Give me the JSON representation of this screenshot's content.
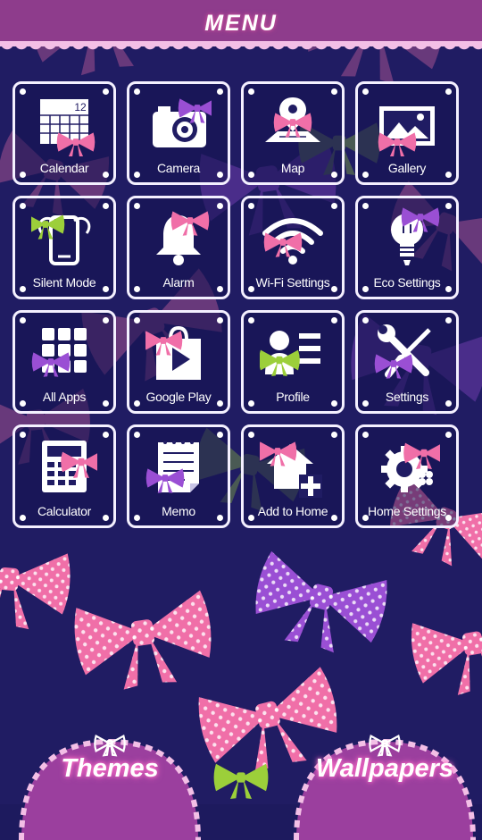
{
  "header": {
    "title": "MENU"
  },
  "tiles": [
    {
      "label": "Calendar",
      "icon": "calendar-icon"
    },
    {
      "label": "Camera",
      "icon": "camera-icon"
    },
    {
      "label": "Map",
      "icon": "map-icon"
    },
    {
      "label": "Gallery",
      "icon": "gallery-icon"
    },
    {
      "label": "Silent Mode",
      "icon": "silent-mode-icon"
    },
    {
      "label": "Alarm",
      "icon": "alarm-bell-icon"
    },
    {
      "label": "Wi-Fi Settings",
      "icon": "wifi-icon"
    },
    {
      "label": "Eco Settings",
      "icon": "lightbulb-icon"
    },
    {
      "label": "All Apps",
      "icon": "all-apps-grid-icon"
    },
    {
      "label": "Google Play",
      "icon": "google-play-bag-icon"
    },
    {
      "label": "Profile",
      "icon": "profile-icon"
    },
    {
      "label": "Settings",
      "icon": "wrench-screwdriver-icon"
    },
    {
      "label": "Calculator",
      "icon": "calculator-icon"
    },
    {
      "label": "Memo",
      "icon": "memo-notepad-icon"
    },
    {
      "label": "Add to Home",
      "icon": "add-to-home-icon"
    },
    {
      "label": "Home Settings",
      "icon": "gear-icon"
    }
  ],
  "calendar_date": "12",
  "bottom": {
    "themes": "Themes",
    "wallpapers": "Wallpapers"
  },
  "colors": {
    "background": "#201c63",
    "header": "#8e3c8c",
    "pink_bow": "#f06fa8",
    "purple_bow": "#9a4fd4",
    "green_bow": "#9ccf3a"
  }
}
